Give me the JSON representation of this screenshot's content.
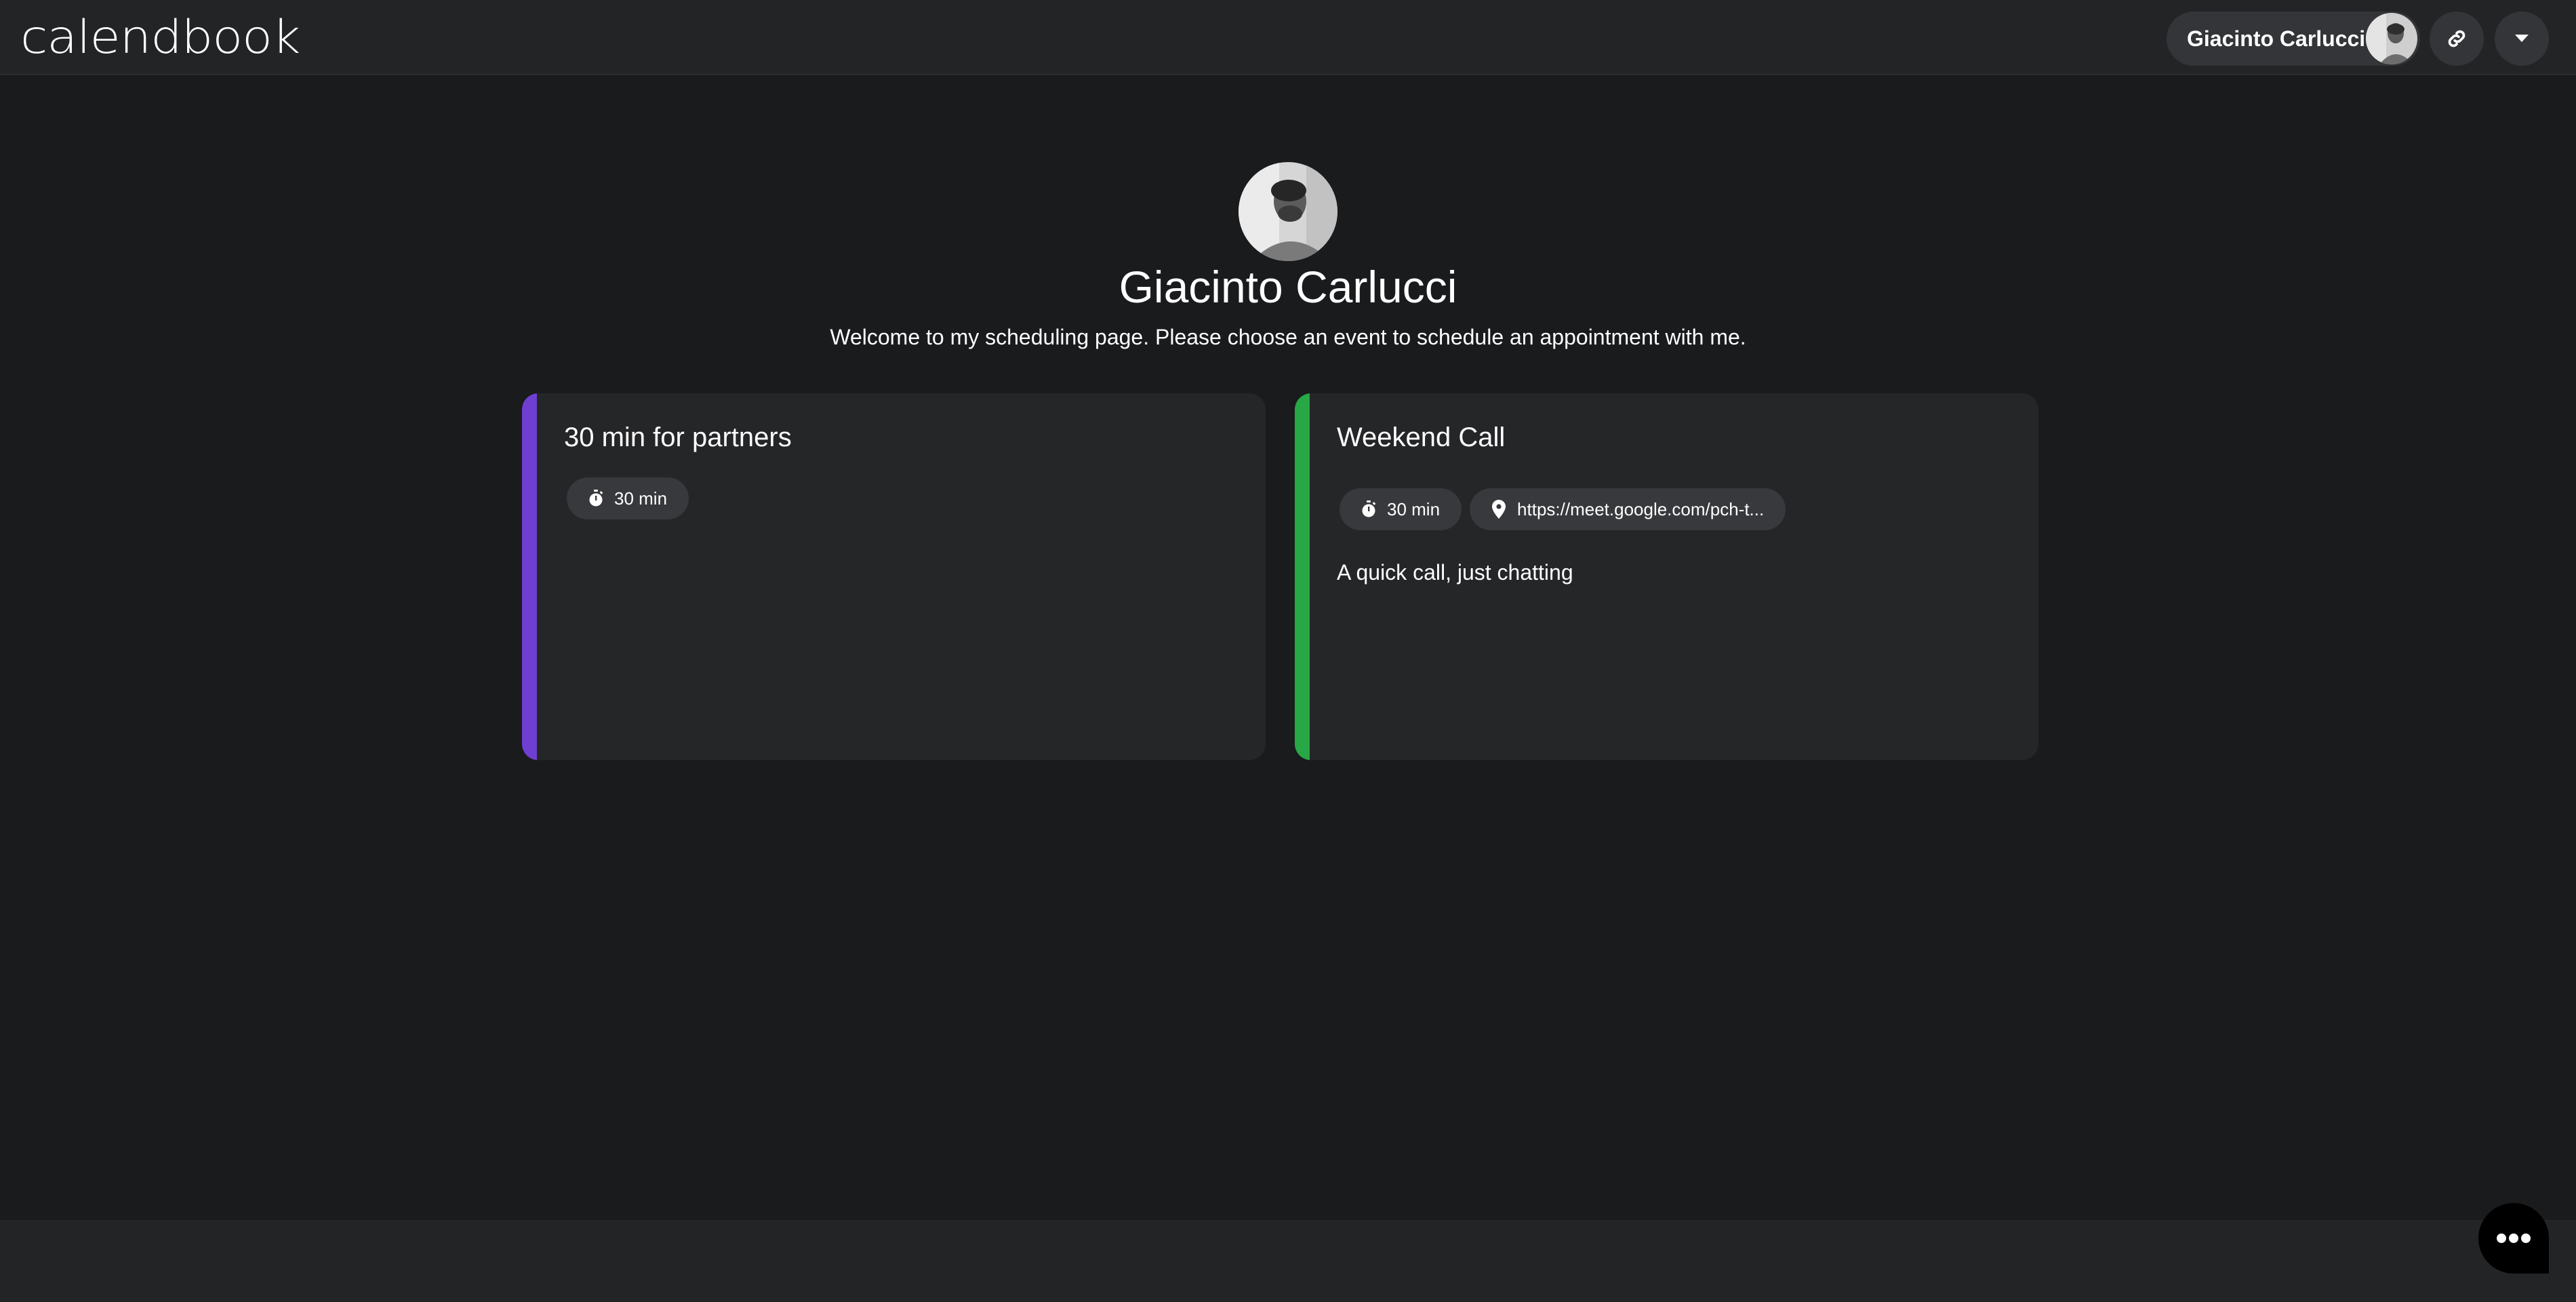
{
  "header": {
    "logo_text": "calendbook",
    "user_name": "Giacinto Carlucci",
    "link_icon": "link-icon",
    "menu_icon": "chevron-down-icon"
  },
  "profile": {
    "name": "Giacinto Carlucci",
    "welcome": "Welcome to my scheduling page. Please choose an event to schedule an appointment with me."
  },
  "events": [
    {
      "title": "30 min for partners",
      "color": "#6f3fd2",
      "duration": "30 min",
      "location": "",
      "description": ""
    },
    {
      "title": "Weekend Call",
      "color": "#27a745",
      "duration": "30 min",
      "location": "https://meet.google.com/pch-t...",
      "description": "A quick call, just chatting"
    }
  ],
  "chat": {
    "icon": "chat-bubble-icon"
  },
  "colors": {
    "background": "#1a1b1d",
    "header": "#232426",
    "card": "#252628",
    "chip": "#38393c"
  }
}
